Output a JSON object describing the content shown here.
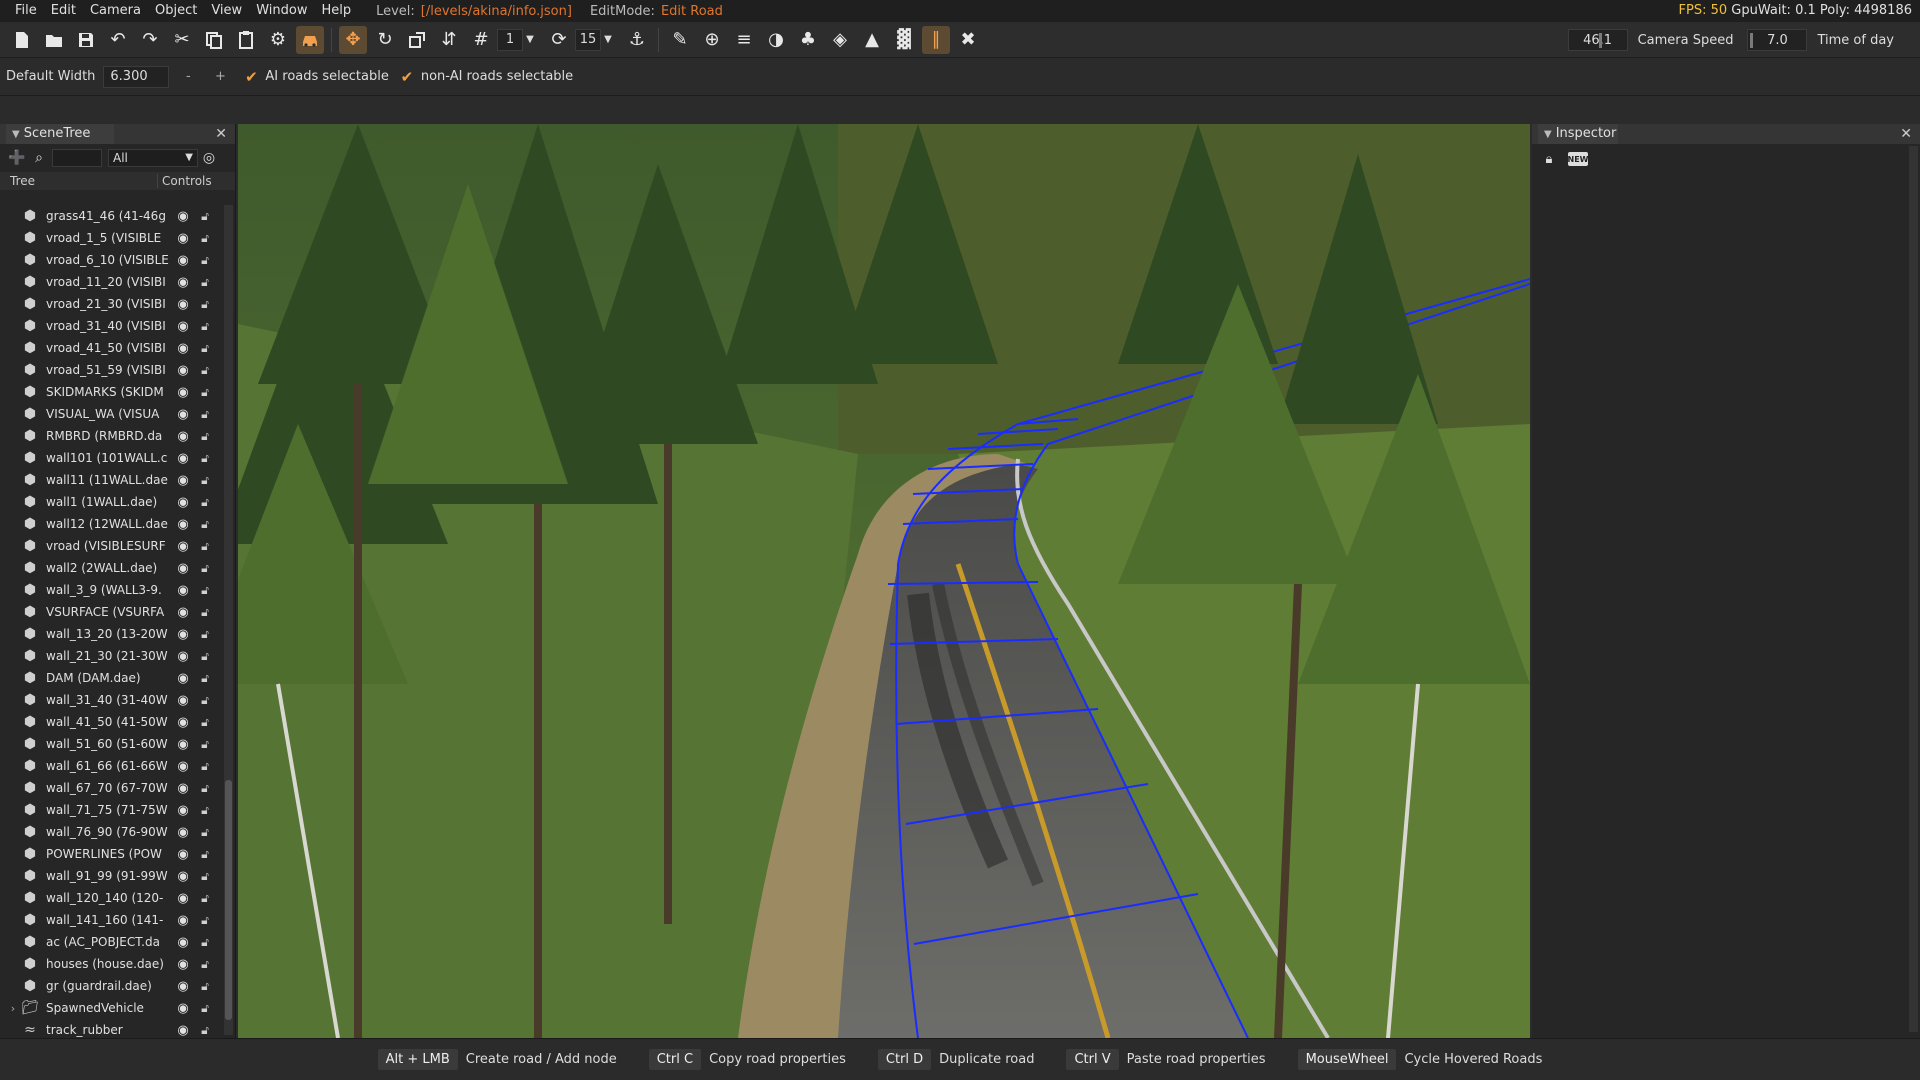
{
  "menu": {
    "items": [
      "File",
      "Edit",
      "Camera",
      "Object",
      "View",
      "Window",
      "Help"
    ],
    "level_label": "Level:",
    "level_value": "[/levels/akina/info.json]",
    "editmode_label": "EditMode:",
    "editmode_value": "Edit Road"
  },
  "perf": {
    "fps": "FPS: 50",
    "gpu": "GpuWait: 0.1",
    "poly": "Poly: 4498186"
  },
  "toolbar": {
    "snap_value": "1",
    "rotate_value": "15"
  },
  "camera": {
    "speed_value": "46.1",
    "speed_label": "Camera Speed",
    "time_value": "7.0",
    "time_label": "Time of day"
  },
  "options": {
    "width_label": "Default Width",
    "width_value": "6.300",
    "minus": "-",
    "plus": "+",
    "ai_roads": "AI roads selectable",
    "nonai_roads": "non-AI roads selectable"
  },
  "scenetree": {
    "title": "SceneTree",
    "filter": "All",
    "col_tree": "Tree",
    "col_controls": "Controls",
    "rows": [
      "grass41_46 (41-46g",
      "vroad_1_5 (VISIBLE",
      "vroad_6_10 (VISIBLE",
      "vroad_11_20 (VISIBI",
      "vroad_21_30 (VISIBI",
      "vroad_31_40 (VISIBI",
      "vroad_41_50 (VISIBI",
      "vroad_51_59 (VISIBI",
      "SKIDMARKS (SKIDM",
      "VISUAL_WA (VISUA",
      "RMBRD (RMBRD.da",
      "wall101 (101WALL.c",
      "wall11 (11WALL.dae",
      "wall1 (1WALL.dae)",
      "wall12 (12WALL.dae",
      "vroad (VISIBLESURF",
      "wall2 (2WALL.dae)",
      "wall_3_9 (WALL3-9.",
      "VSURFACE (VSURFA",
      "wall_13_20 (13-20W",
      "wall_21_30 (21-30W",
      "DAM (DAM.dae)",
      "wall_31_40 (31-40W",
      "wall_41_50 (41-50W",
      "wall_51_60 (51-60W",
      "wall_61_66 (61-66W",
      "wall_67_70 (67-70W",
      "wall_71_75 (71-75W",
      "wall_76_90 (76-90W",
      "POWERLINES (POW",
      "wall_91_99 (91-99W",
      "wall_120_140 (120-",
      "wall_141_160 (141-",
      "ac (AC_POBJECT.da",
      "houses (house.dae)",
      "gr (guardrail.dae)",
      "SpawnedVehicle",
      "track_rubber"
    ]
  },
  "inspector": {
    "title": "Inspector",
    "new_badge": "NEW"
  },
  "hints": [
    {
      "key": "Alt + LMB",
      "desc": "Create road / Add node"
    },
    {
      "key": "Ctrl C",
      "desc": "Copy road properties"
    },
    {
      "key": "Ctrl D",
      "desc": "Duplicate road"
    },
    {
      "key": "Ctrl V",
      "desc": "Paste road properties"
    },
    {
      "key": "MouseWheel",
      "desc": "Cycle Hovered Roads"
    }
  ],
  "colors": {
    "accent": "#e0752d",
    "fps": "#f0c040",
    "road_spline": "#1a2cff",
    "check": "#f0a040"
  }
}
